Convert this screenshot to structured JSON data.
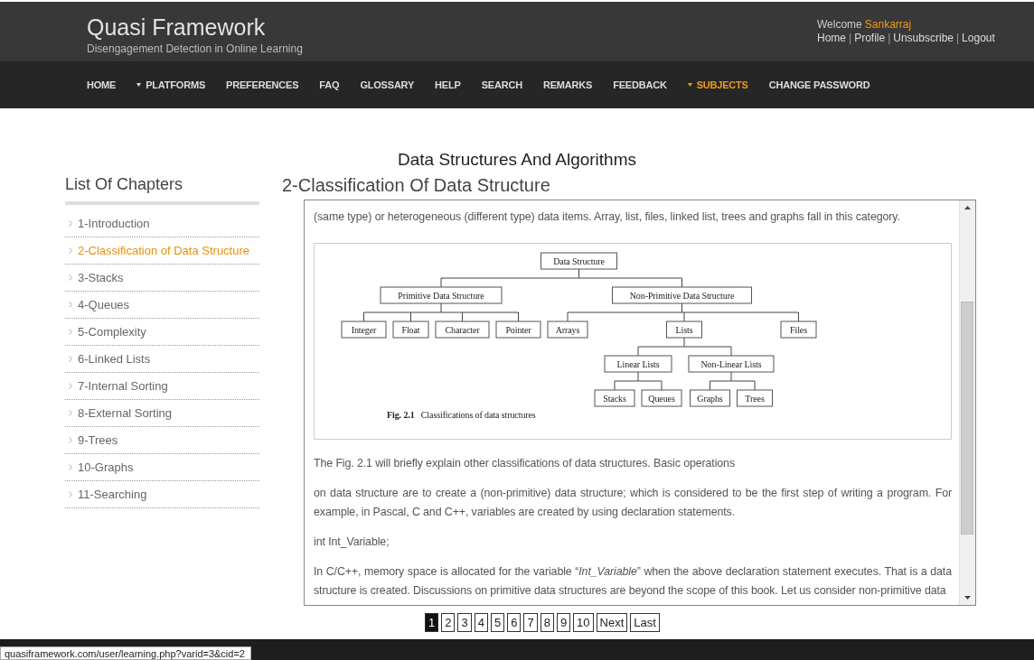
{
  "header": {
    "title": "Quasi Framework",
    "subtitle": "Disengagement Detection in Online Learning",
    "welcome": "Welcome",
    "username": "Sankarraj",
    "user_links": [
      {
        "label": "Home",
        "kind": "link"
      },
      {
        "label": "|",
        "kind": "separator"
      },
      {
        "label": "Profile",
        "kind": "link"
      },
      {
        "label": "|",
        "kind": "separator"
      },
      {
        "label": "Unsubscribe",
        "kind": "link"
      },
      {
        "label": "|",
        "kind": "separator"
      },
      {
        "label": "Logout",
        "kind": "link"
      }
    ]
  },
  "nav": [
    {
      "label": "HOME",
      "dropdown": false,
      "selected": false
    },
    {
      "label": "PLATFORMS",
      "dropdown": true,
      "selected": false
    },
    {
      "label": "PREFERENCES",
      "dropdown": false,
      "selected": false
    },
    {
      "label": "FAQ",
      "dropdown": false,
      "selected": false
    },
    {
      "label": "GLOSSARY",
      "dropdown": false,
      "selected": false
    },
    {
      "label": "HELP",
      "dropdown": false,
      "selected": false
    },
    {
      "label": "SEARCH",
      "dropdown": false,
      "selected": false
    },
    {
      "label": "REMARKS",
      "dropdown": false,
      "selected": false
    },
    {
      "label": "FEEDBACK",
      "dropdown": false,
      "selected": false
    },
    {
      "label": "SUBJECTS",
      "dropdown": true,
      "selected": true
    },
    {
      "label": "CHANGE PASSWORD",
      "dropdown": false,
      "selected": false
    }
  ],
  "page_title": "Data Structures And Algorithms",
  "sidebar": {
    "title": "List Of Chapters",
    "items": [
      {
        "label": "1-Introduction",
        "selected": false
      },
      {
        "label": "2-Classification of Data Structure",
        "selected": true
      },
      {
        "label": "3-Stacks",
        "selected": false
      },
      {
        "label": "4-Queues",
        "selected": false
      },
      {
        "label": "5-Complexity",
        "selected": false
      },
      {
        "label": "6-Linked Lists",
        "selected": false
      },
      {
        "label": "7-Internal Sorting",
        "selected": false
      },
      {
        "label": "8-External Sorting",
        "selected": false
      },
      {
        "label": "9-Trees",
        "selected": false
      },
      {
        "label": "10-Graphs",
        "selected": false
      },
      {
        "label": "11-Searching",
        "selected": false
      }
    ]
  },
  "lesson": {
    "title": "2-Classification Of Data Structure",
    "blocks": [
      {
        "kind": "text",
        "text": "(same type) or heterogeneous (different type) data items. Array, list, files, linked list, trees and graphs fall in this category."
      },
      {
        "kind": "figure",
        "caption": "**Fig. 2.1**   Classifications of data structures",
        "tree": {
          "label": "Data Structure",
          "children": [
            {
              "label": "Primitive Data Structure",
              "children": [
                {
                  "label": "Integer"
                },
                {
                  "label": "Float"
                },
                {
                  "label": "Character"
                },
                {
                  "label": "Pointer"
                }
              ]
            },
            {
              "label": "Non-Primitive Data Structure",
              "children": [
                {
                  "label": "Arrays"
                },
                {
                  "label": "Lists",
                  "children": [
                    {
                      "label": "Linear Lists",
                      "children": [
                        {
                          "label": "Stacks"
                        },
                        {
                          "label": "Queues"
                        }
                      ]
                    },
                    {
                      "label": "Non-Linear Lists",
                      "children": [
                        {
                          "label": "Graphs"
                        },
                        {
                          "label": "Trees"
                        }
                      ]
                    }
                  ]
                },
                {
                  "label": "Files"
                }
              ]
            }
          ]
        }
      },
      {
        "kind": "text",
        "text": "The Fig. 2.1 will briefly explain other classifications of data structures. Basic operations"
      },
      {
        "kind": "text",
        "text": "on data structure are to create a (non-primitive) data structure; which is considered to be the first step of writing a program. For example, in Pascal, C and C++, variables are created by using declaration statements."
      },
      {
        "kind": "text",
        "text": "int Int_Variable;"
      },
      {
        "kind": "text",
        "text": "In C/C++, memory space is allocated for the variable “*Int_Variable*” when the above declaration statement executes. That is a data structure is created. Discussions on primitive data structures are beyond the scope of this book. Let us consider non-primitive data"
      }
    ]
  },
  "pagination": [
    {
      "label": "1",
      "selected": true
    },
    {
      "label": "2",
      "selected": false
    },
    {
      "label": "3",
      "selected": false
    },
    {
      "label": "4",
      "selected": false
    },
    {
      "label": "5",
      "selected": false
    },
    {
      "label": "6",
      "selected": false
    },
    {
      "label": "7",
      "selected": false
    },
    {
      "label": "8",
      "selected": false
    },
    {
      "label": "9",
      "selected": false
    },
    {
      "label": "10",
      "selected": false
    },
    {
      "label": "Next",
      "selected": false
    },
    {
      "label": "Last",
      "selected": false
    }
  ],
  "status_bar": {
    "url": "quasiframework.com/user/learning.php?varid=3&cid=2"
  }
}
